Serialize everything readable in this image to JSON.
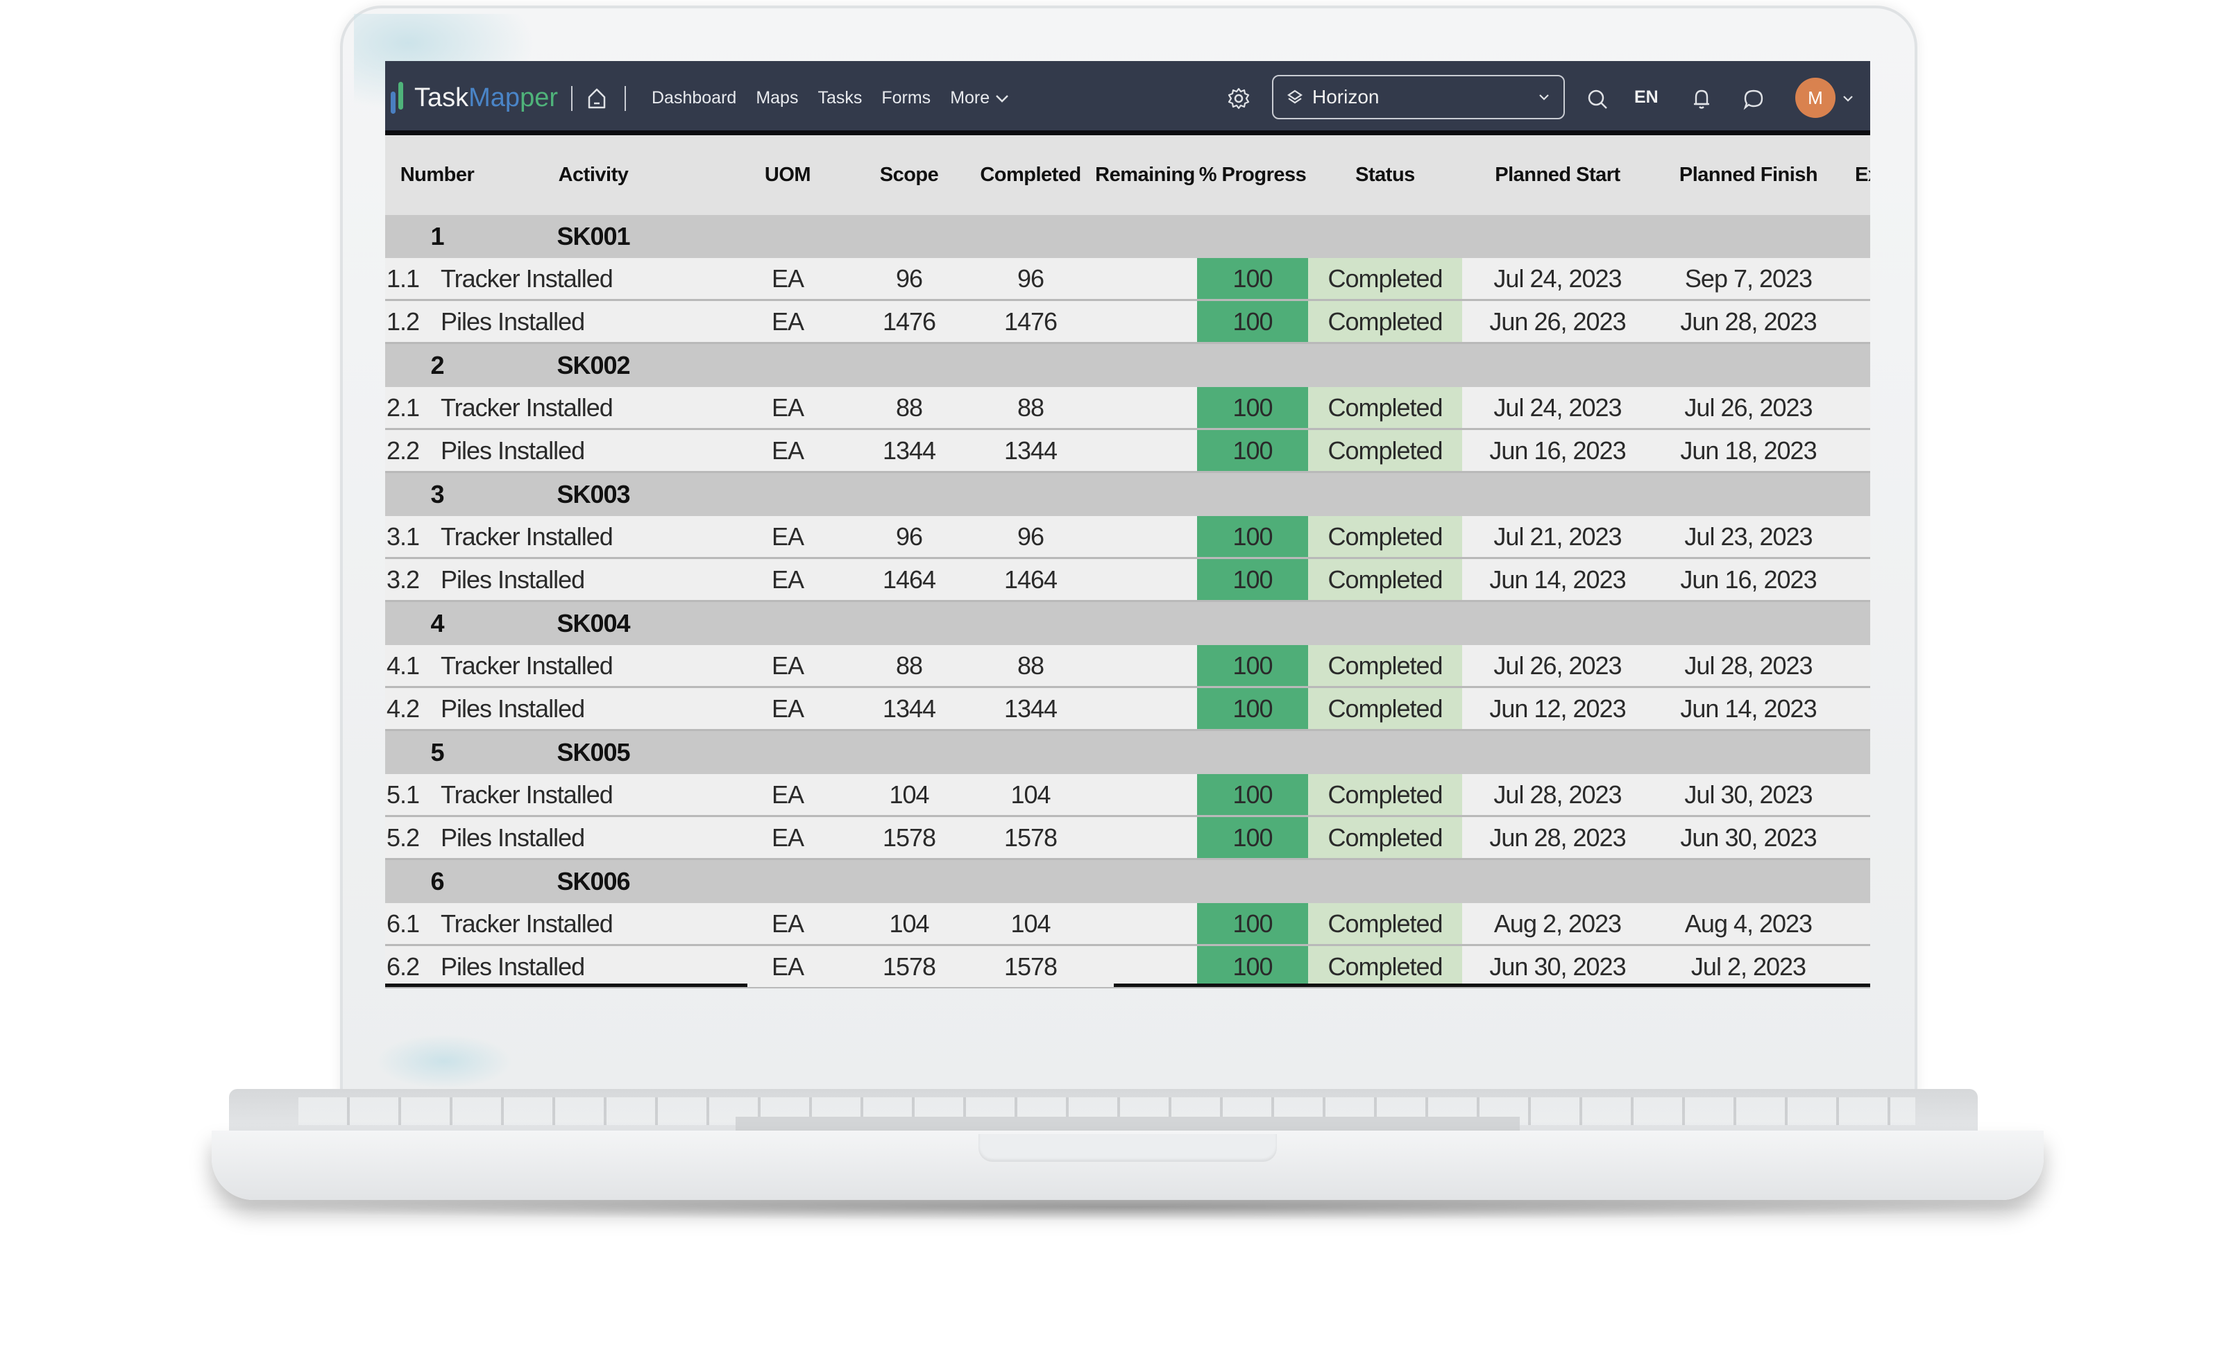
{
  "app": {
    "logo_part1": "Task",
    "logo_part2": "Map",
    "logo_part3": "per"
  },
  "nav": {
    "links": [
      {
        "label": "Dashboard"
      },
      {
        "label": "Maps"
      },
      {
        "label": "Tasks"
      },
      {
        "label": "Forms"
      },
      {
        "label": "More"
      }
    ],
    "project_selector": {
      "value": "Horizon"
    },
    "language": "EN",
    "avatar_initial": "M"
  },
  "colors": {
    "navbar": "#333a4b",
    "progress_fill": "#4fae78",
    "status_fill": "#d1e3c9",
    "avatar": "#d9824f"
  },
  "table": {
    "columns": [
      "Number",
      "Activity",
      "UOM",
      "Scope",
      "Completed",
      "Remaining",
      "% Progress",
      "Status",
      "Planned Start",
      "Planned Finish",
      "Ex"
    ],
    "rows": [
      {
        "type": "group",
        "number": "1",
        "activity": "SK001"
      },
      {
        "type": "item",
        "number": "1.1",
        "activity": "Tracker Installed",
        "uom": "EA",
        "scope": "96",
        "completed": "96",
        "remaining": "",
        "progress": "100",
        "status": "Completed",
        "planned_start": "Jul 24, 2023",
        "planned_finish": "Sep 7, 2023"
      },
      {
        "type": "item",
        "number": "1.2",
        "activity": "Piles Installed",
        "uom": "EA",
        "scope": "1476",
        "completed": "1476",
        "remaining": "",
        "progress": "100",
        "status": "Completed",
        "planned_start": "Jun 26, 2023",
        "planned_finish": "Jun 28, 2023"
      },
      {
        "type": "group",
        "number": "2",
        "activity": "SK002"
      },
      {
        "type": "item",
        "number": "2.1",
        "activity": "Tracker Installed",
        "uom": "EA",
        "scope": "88",
        "completed": "88",
        "remaining": "",
        "progress": "100",
        "status": "Completed",
        "planned_start": "Jul 24, 2023",
        "planned_finish": "Jul 26, 2023"
      },
      {
        "type": "item",
        "number": "2.2",
        "activity": "Piles Installed",
        "uom": "EA",
        "scope": "1344",
        "completed": "1344",
        "remaining": "",
        "progress": "100",
        "status": "Completed",
        "planned_start": "Jun 16, 2023",
        "planned_finish": "Jun 18, 2023"
      },
      {
        "type": "group",
        "number": "3",
        "activity": "SK003"
      },
      {
        "type": "item",
        "number": "3.1",
        "activity": "Tracker Installed",
        "uom": "EA",
        "scope": "96",
        "completed": "96",
        "remaining": "",
        "progress": "100",
        "status": "Completed",
        "planned_start": "Jul 21, 2023",
        "planned_finish": "Jul 23, 2023"
      },
      {
        "type": "item",
        "number": "3.2",
        "activity": "Piles Installed",
        "uom": "EA",
        "scope": "1464",
        "completed": "1464",
        "remaining": "",
        "progress": "100",
        "status": "Completed",
        "planned_start": "Jun 14, 2023",
        "planned_finish": "Jun 16, 2023"
      },
      {
        "type": "group",
        "number": "4",
        "activity": "SK004"
      },
      {
        "type": "item",
        "number": "4.1",
        "activity": "Tracker Installed",
        "uom": "EA",
        "scope": "88",
        "completed": "88",
        "remaining": "",
        "progress": "100",
        "status": "Completed",
        "planned_start": "Jul 26, 2023",
        "planned_finish": "Jul 28, 2023"
      },
      {
        "type": "item",
        "number": "4.2",
        "activity": "Piles Installed",
        "uom": "EA",
        "scope": "1344",
        "completed": "1344",
        "remaining": "",
        "progress": "100",
        "status": "Completed",
        "planned_start": "Jun 12, 2023",
        "planned_finish": "Jun 14, 2023"
      },
      {
        "type": "group",
        "number": "5",
        "activity": "SK005"
      },
      {
        "type": "item",
        "number": "5.1",
        "activity": "Tracker Installed",
        "uom": "EA",
        "scope": "104",
        "completed": "104",
        "remaining": "",
        "progress": "100",
        "status": "Completed",
        "planned_start": "Jul 28, 2023",
        "planned_finish": "Jul 30, 2023"
      },
      {
        "type": "item",
        "number": "5.2",
        "activity": "Piles Installed",
        "uom": "EA",
        "scope": "1578",
        "completed": "1578",
        "remaining": "",
        "progress": "100",
        "status": "Completed",
        "planned_start": "Jun 28, 2023",
        "planned_finish": "Jun 30, 2023"
      },
      {
        "type": "group",
        "number": "6",
        "activity": "SK006"
      },
      {
        "type": "item",
        "number": "6.1",
        "activity": "Tracker Installed",
        "uom": "EA",
        "scope": "104",
        "completed": "104",
        "remaining": "",
        "progress": "100",
        "status": "Completed",
        "planned_start": "Aug 2, 2023",
        "planned_finish": "Aug 4, 2023"
      },
      {
        "type": "item",
        "number": "6.2",
        "activity": "Piles Installed",
        "uom": "EA",
        "scope": "1578",
        "completed": "1578",
        "remaining": "",
        "progress": "100",
        "status": "Completed",
        "planned_start": "Jun 30, 2023",
        "planned_finish": "Jul 2, 2023"
      }
    ]
  }
}
